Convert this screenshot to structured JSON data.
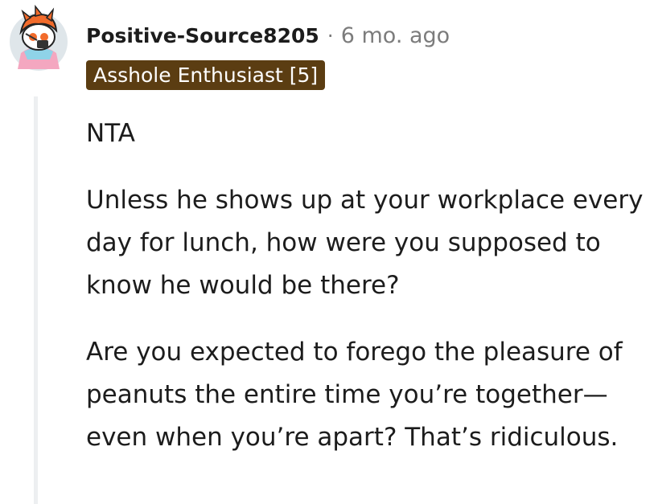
{
  "comment": {
    "author": "Positive-Source8205",
    "separator": "·",
    "time": "6 mo. ago",
    "flair": "Asshole Enthusiast [5]",
    "paragraphs": [
      "NTA",
      "Unless he shows up at your workplace every day for lunch, how were you supposed to know he would be there?",
      "Are you expected to forego the pleasure of peanuts the entire time you’re together—even when you’re apart? That’s ridiculous."
    ]
  },
  "icons": {
    "avatar": "snoo-avatar-icon"
  },
  "colors": {
    "flair_background": "#5b3d12",
    "flair_text": "#ffffff",
    "thread_line": "#edeff1",
    "meta_text": "#7c7c7c"
  }
}
